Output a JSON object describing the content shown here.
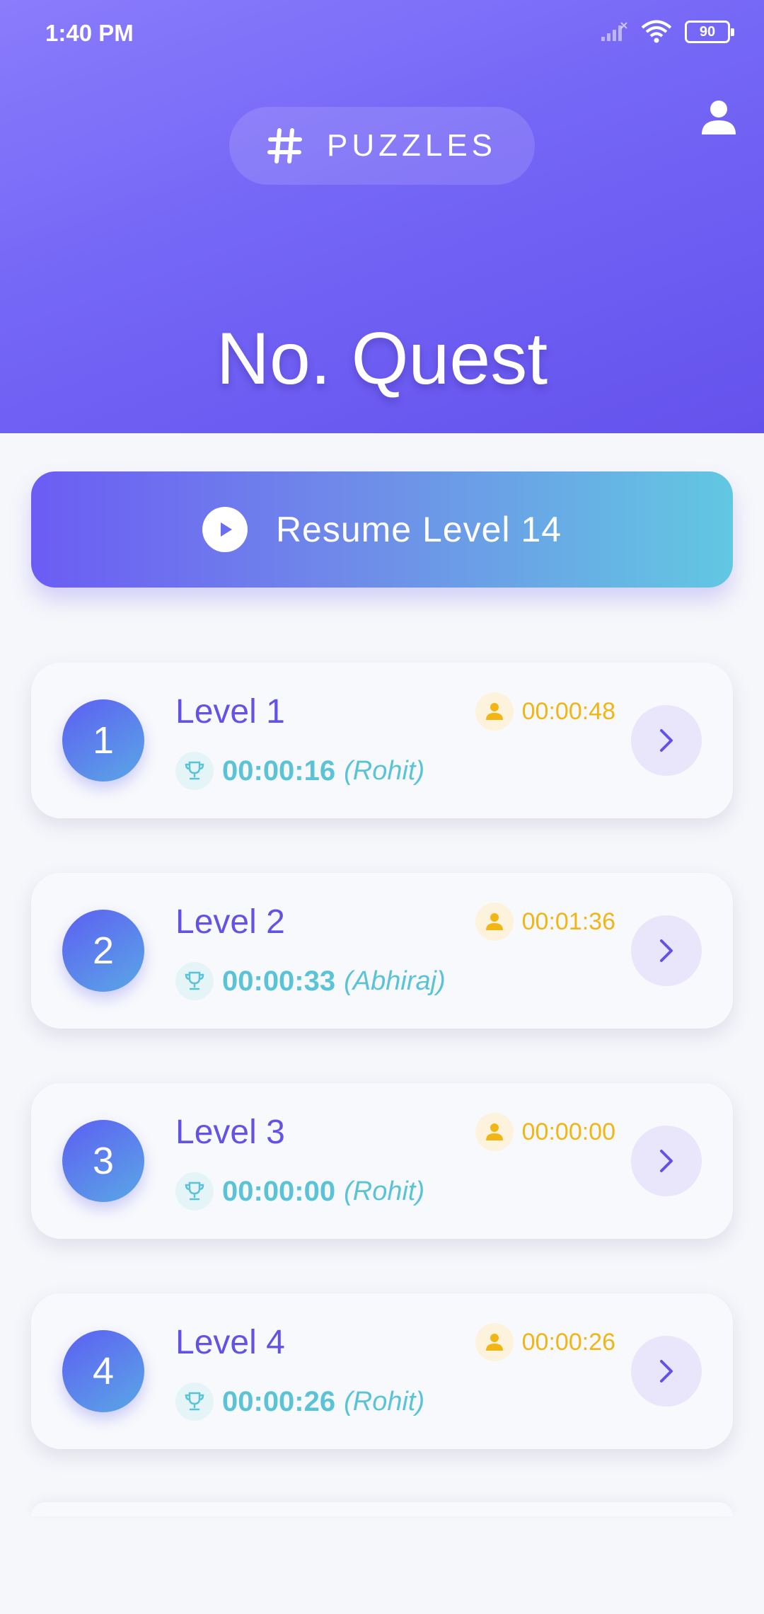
{
  "status_bar": {
    "time": "1:40 PM",
    "battery": "90",
    "icons": [
      "signal-icon",
      "wifi-icon",
      "battery-icon"
    ]
  },
  "header": {
    "section_label": "PUZZLES",
    "section_icon": "hash-icon",
    "app_title": "No. Quest",
    "profile_icon": "person-icon"
  },
  "resume": {
    "label": "Resume Level 14",
    "icon": "play-icon"
  },
  "levels": [
    {
      "number": "1",
      "name": "Level 1",
      "my_time": "00:00:48",
      "best_time": "00:00:16",
      "best_player": "(Rohit)"
    },
    {
      "number": "2",
      "name": "Level 2",
      "my_time": "00:01:36",
      "best_time": "00:00:33",
      "best_player": "(Abhiraj)"
    },
    {
      "number": "3",
      "name": "Level 3",
      "my_time": "00:00:00",
      "best_time": "00:00:00",
      "best_player": "(Rohit)"
    },
    {
      "number": "4",
      "name": "Level 4",
      "my_time": "00:00:26",
      "best_time": "00:00:26",
      "best_player": "(Rohit)"
    }
  ],
  "colors": {
    "header_start": "#8a7cfb",
    "header_end": "#6452ec",
    "level_title": "#6352e6",
    "best_time": "#5bc3d8",
    "my_time": "#f1b516",
    "arrow_bg": "#e9e6fb"
  }
}
